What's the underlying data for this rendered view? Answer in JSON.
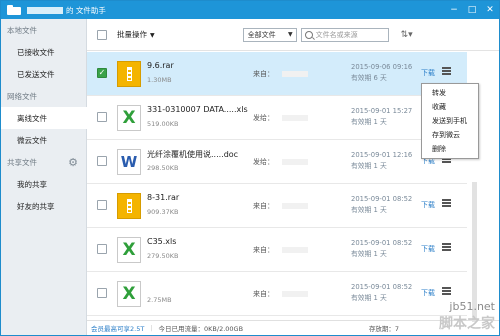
{
  "title": "的 文件助手",
  "sidebar": {
    "sections": [
      {
        "label": "本地文件",
        "items": [
          "已接收文件",
          "已发送文件"
        ]
      },
      {
        "label": "网络文件",
        "items": [
          "离线文件",
          "微云文件"
        ]
      },
      {
        "label": "共享文件",
        "items": [
          "我的共享",
          "好友的共享"
        ]
      }
    ],
    "active": "离线文件"
  },
  "toolbar": {
    "batch_label": "批量操作",
    "filter_value": "全部文件",
    "search_placeholder": "文件名或来源"
  },
  "files": [
    {
      "name": "9.6.rar",
      "size": "1.30MB",
      "origin_label": "来自：",
      "date": "2015-09-06 09:16",
      "expiry": "有效期 6 天",
      "download": "下载",
      "type": "zip",
      "selected": true
    },
    {
      "name": "331-0310007 DATA.....xls",
      "size": "519.00KB",
      "origin_label": "发给：",
      "date": "2015-09-01 15:27",
      "expiry": "有效期 1 天",
      "download": "下载",
      "type": "xls",
      "selected": false
    },
    {
      "name": "光纤涂覆机使用说.....doc",
      "size": "298.50KB",
      "origin_label": "发给：",
      "date": "2015-09-01 12:16",
      "expiry": "有效期 1 天",
      "download": "下载",
      "type": "doc",
      "selected": false
    },
    {
      "name": "8-31.rar",
      "size": "909.37KB",
      "origin_label": "来自：",
      "date": "2015-09-01 08:52",
      "expiry": "有效期 1 天",
      "download": "下载",
      "type": "zip",
      "selected": false
    },
    {
      "name": "C35.xls",
      "size": "279.50KB",
      "origin_label": "来自：",
      "date": "2015-09-01 08:52",
      "expiry": "有效期 1 天",
      "download": "下载",
      "type": "xls",
      "selected": false
    },
    {
      "name": "",
      "size": "2.75MB",
      "origin_label": "来自：",
      "date": "2015-09-01 08:52",
      "expiry": "有效期 1 天",
      "download": "下载",
      "type": "xls",
      "selected": false
    }
  ],
  "context_menu": [
    "转发",
    "收藏",
    "发送到手机",
    "存到微云",
    "删除"
  ],
  "status": {
    "vip": "会员最高可享2.5T",
    "today_traffic": "今日已用流量：0KB/2.00GB",
    "count": "存放期：7"
  },
  "watermark": {
    "line1": "jb51.net",
    "line2": "脚本之家"
  }
}
